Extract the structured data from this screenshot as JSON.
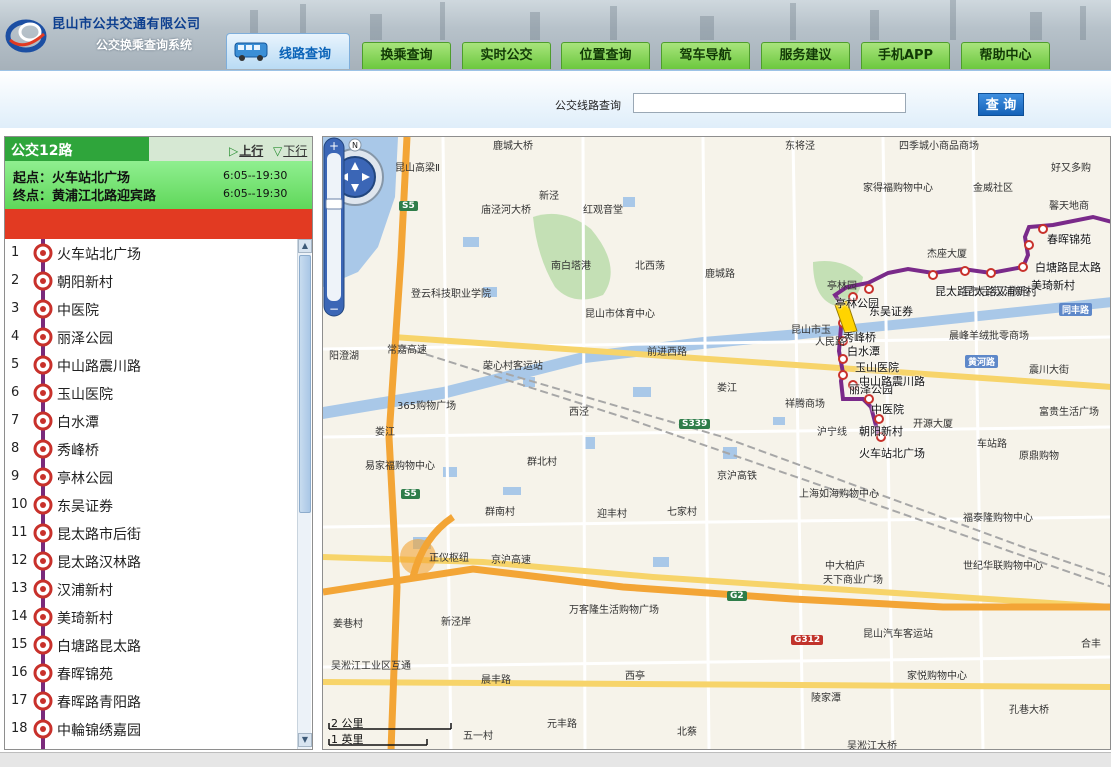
{
  "header": {
    "company_name": "昆山市公共交通有限公司",
    "system_name": "公交换乘查询系统",
    "active_tab": "线路查询",
    "tabs": [
      "换乘查询",
      "实时公交",
      "位置查询",
      "驾车导航",
      "服务建议",
      "手机APP",
      "帮助中心"
    ]
  },
  "search": {
    "label": "公交线路查询",
    "value": "",
    "button": "查 询"
  },
  "route": {
    "name": "公交12路",
    "up_label": "上行",
    "down_label": "下行",
    "start_prefix": "起点：",
    "start_name": "火车站北广场",
    "start_time": "6:05--19:30",
    "end_prefix": "终点：",
    "end_name": "黄浦江北路迎宾路",
    "end_time": "6:05--19:30"
  },
  "stops": [
    {
      "n": "1",
      "name": "火车站北广场"
    },
    {
      "n": "2",
      "name": "朝阳新村"
    },
    {
      "n": "3",
      "name": "中医院"
    },
    {
      "n": "4",
      "name": "丽泽公园"
    },
    {
      "n": "5",
      "name": "中山路震川路"
    },
    {
      "n": "6",
      "name": "玉山医院"
    },
    {
      "n": "7",
      "name": "白水潭"
    },
    {
      "n": "8",
      "name": "秀峰桥"
    },
    {
      "n": "9",
      "name": "亭林公园"
    },
    {
      "n": "10",
      "name": "东吴证券"
    },
    {
      "n": "11",
      "name": "昆太路市后街"
    },
    {
      "n": "12",
      "name": "昆太路汉林路"
    },
    {
      "n": "13",
      "name": "汉浦新村"
    },
    {
      "n": "14",
      "name": "美琦新村"
    },
    {
      "n": "15",
      "name": "白塘路昆太路"
    },
    {
      "n": "16",
      "name": "春晖锦苑"
    },
    {
      "n": "17",
      "name": "春晖路青阳路"
    },
    {
      "n": "18",
      "name": "中輪锦绣嘉园"
    }
  ],
  "map": {
    "scale_km": "2 公里",
    "scale_mi": "1 英里",
    "roads": {
      "s5_top": "S5",
      "s5_bottom": "S5",
      "s339": "S339",
      "g2": "G2",
      "g312": "G312",
      "huanghe": "黄河路",
      "tongfeng": "同丰路"
    },
    "labels": [
      {
        "t": "鹿城大桥"
      },
      {
        "t": "东将泾"
      },
      {
        "t": "昆山高梁Ⅱ"
      },
      {
        "t": "新泾"
      },
      {
        "t": "庙泾河大桥"
      },
      {
        "t": "红观音堂"
      },
      {
        "t": "南白塔港"
      },
      {
        "t": "北西荡"
      },
      {
        "t": "鹿城路"
      },
      {
        "t": "登云科技职业学院"
      },
      {
        "t": "昆山市体育中心"
      },
      {
        "t": "阳澄湖"
      },
      {
        "t": "常嘉高速"
      },
      {
        "t": "荣心村客运站"
      },
      {
        "t": "前进西路"
      },
      {
        "t": "娄江"
      },
      {
        "t": "西泾"
      },
      {
        "t": "365购物广场"
      },
      {
        "t": "娄江"
      },
      {
        "t": "沪宁线"
      },
      {
        "t": "祥腾商场"
      },
      {
        "t": "易家福购物中心"
      },
      {
        "t": "群北村"
      },
      {
        "t": "京沪高铁"
      },
      {
        "t": "群南村"
      },
      {
        "t": "迎丰村"
      },
      {
        "t": "七家村"
      },
      {
        "t": "上海如海购物中心"
      },
      {
        "t": "正仪枢纽"
      },
      {
        "t": "京沪高速"
      },
      {
        "t": "中大柏庐"
      },
      {
        "t": "天下商业广场"
      },
      {
        "t": "姜巷村"
      },
      {
        "t": "新泾岸"
      },
      {
        "t": "万客隆生活购物广场"
      },
      {
        "t": "昆山汽车客运站"
      },
      {
        "t": "吴淞江工业区互通"
      },
      {
        "t": "晨丰路"
      },
      {
        "t": "西亭"
      },
      {
        "t": "家悦购物中心"
      },
      {
        "t": "陵家潭"
      },
      {
        "t": "五一村"
      },
      {
        "t": "元丰路"
      },
      {
        "t": "北蔡"
      },
      {
        "t": "吴淞江大桥"
      },
      {
        "t": "孔巷大桥"
      },
      {
        "t": "四季城小商品商场"
      },
      {
        "t": "家得福购物中心"
      },
      {
        "t": "金威社区"
      },
      {
        "t": "好又多购"
      },
      {
        "t": "馨天地商"
      },
      {
        "t": "杰座大厦"
      },
      {
        "t": "亭林园"
      },
      {
        "t": "晨峰羊绒批零商场"
      },
      {
        "t": "昆山市玉"
      },
      {
        "t": "人民路"
      },
      {
        "t": "震川大街"
      },
      {
        "t": "富贵生活广场"
      },
      {
        "t": "开源大厦"
      },
      {
        "t": "原鼎购物"
      },
      {
        "t": "车站路"
      },
      {
        "t": "福泰隆购物中心"
      },
      {
        "t": "世纪华联购物中心"
      },
      {
        "t": "合丰"
      }
    ],
    "stop_labels": [
      {
        "t": "火车站北广场"
      },
      {
        "t": "朝阳新村"
      },
      {
        "t": "中医院"
      },
      {
        "t": "丽泽公园"
      },
      {
        "t": "中山路震川路"
      },
      {
        "t": "玉山医院"
      },
      {
        "t": "白水潭"
      },
      {
        "t": "秀峰桥"
      },
      {
        "t": "亭林公园"
      },
      {
        "t": "东吴证券"
      },
      {
        "t": "昆太路市后街"
      },
      {
        "t": "昆太路汉林路"
      },
      {
        "t": "汉浦新村"
      },
      {
        "t": "美琦新村"
      },
      {
        "t": "白塘路昆太路"
      },
      {
        "t": "春晖锦苑"
      }
    ]
  }
}
